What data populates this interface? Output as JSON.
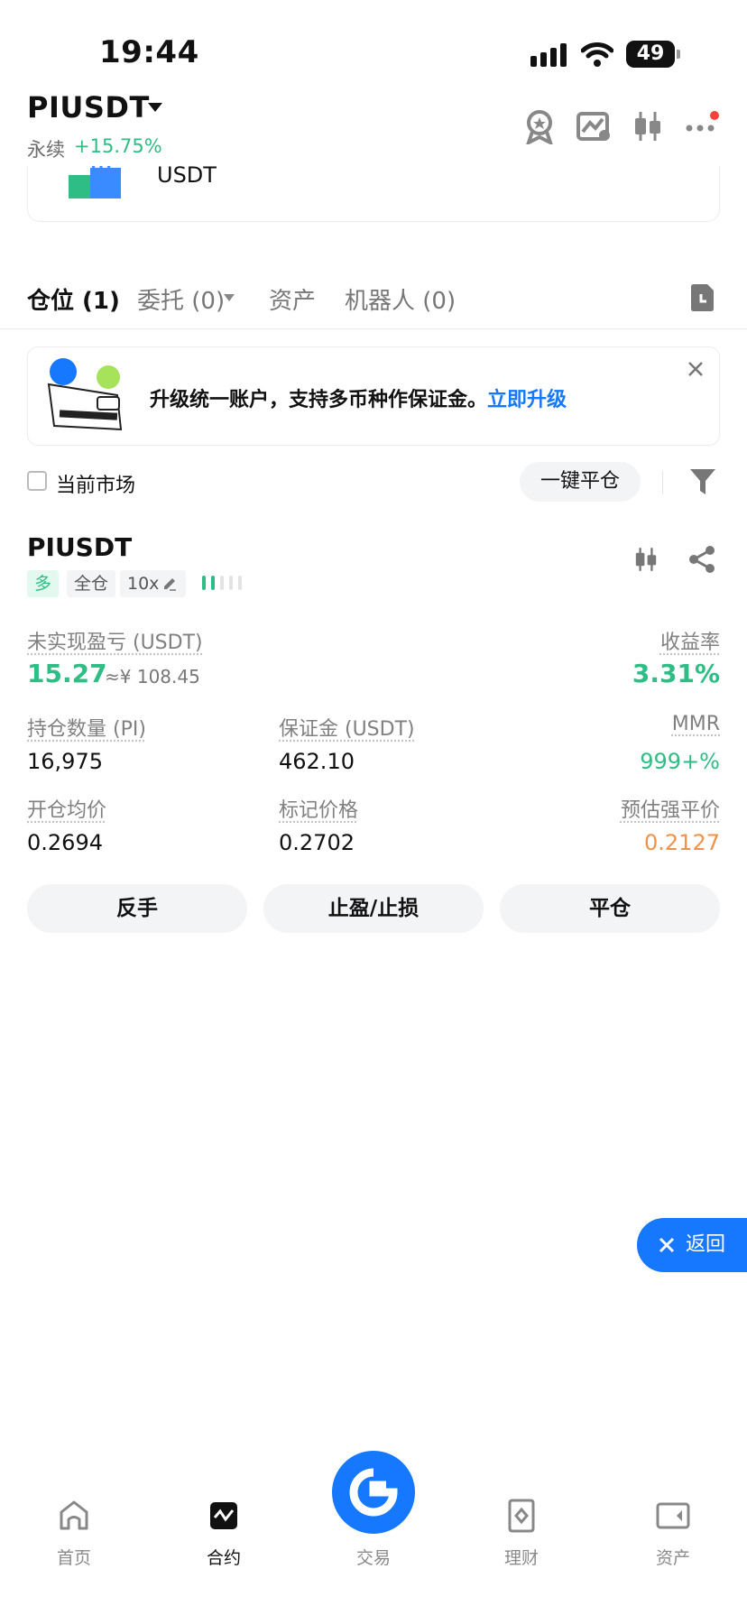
{
  "status_bar": {
    "time": "19:44",
    "battery": "49"
  },
  "header": {
    "symbol": "PIUSDT",
    "perp_label": "永续",
    "change": "+15.75%"
  },
  "top_card": {
    "asset_label": "USDT"
  },
  "tabs": [
    {
      "label": "仓位 (1)"
    },
    {
      "label": "委托 (0)"
    },
    {
      "label": "资产"
    },
    {
      "label": "机器人 (0)"
    }
  ],
  "banner": {
    "text": "升级统一账户，支持多币种作保证金。",
    "link": "立即升级"
  },
  "filter": {
    "current_market": "当前市场",
    "close_all": "一键平仓"
  },
  "position": {
    "symbol": "PIUSDT",
    "side": "多",
    "margin_mode": "全仓",
    "leverage": "10x",
    "unrealized_pnl_label": "未实现盈亏 (USDT)",
    "unrealized_pnl": "15.27",
    "unrealized_pnl_cny": "≈¥ 108.45",
    "roe_label": "收益率",
    "roe": "3.31%",
    "qty_label": "持仓数量 (PI)",
    "qty": "16,975",
    "margin_label": "保证金 (USDT)",
    "margin": "462.10",
    "mmr_label": "MMR",
    "mmr": "999+%",
    "entry_label": "开仓均价",
    "entry": "0.2694",
    "mark_label": "标记价格",
    "mark": "0.2702",
    "liq_label": "预估强平价",
    "liq": "0.2127"
  },
  "actions": {
    "reverse": "反手",
    "tpsl": "止盈/止损",
    "close": "平仓"
  },
  "back_button": {
    "label": "返回"
  },
  "bottom_nav": [
    {
      "label": "首页",
      "icon": "home-icon"
    },
    {
      "label": "合约",
      "icon": "futures-icon"
    },
    {
      "label": "交易",
      "icon": "trade-icon"
    },
    {
      "label": "理财",
      "icon": "earn-icon"
    },
    {
      "label": "资产",
      "icon": "assets-icon"
    }
  ],
  "colors": {
    "green": "#2ebd85",
    "blue": "#1677ff",
    "orange": "#f0924a",
    "red": "#f5433b"
  }
}
